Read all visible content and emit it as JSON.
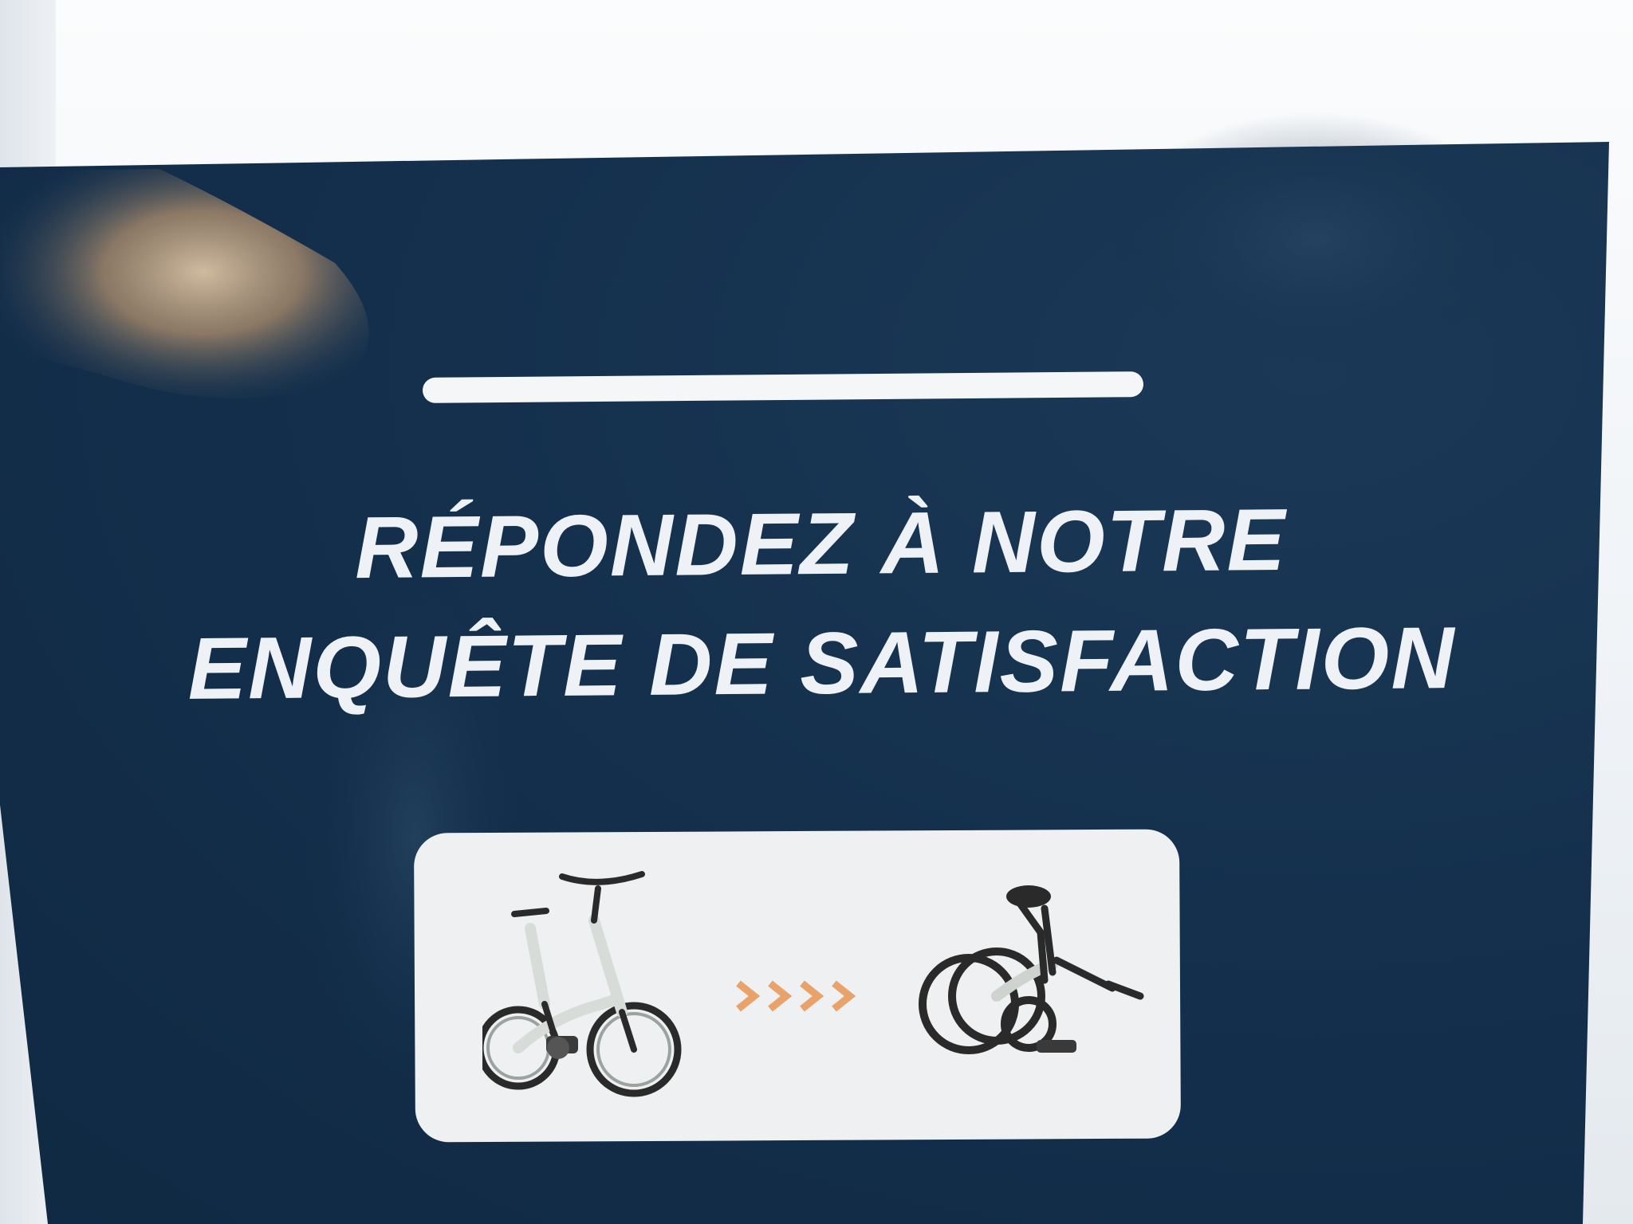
{
  "sign": {
    "headline_line1": "RÉPONDEZ À NOTRE",
    "headline_line2": "ENQUÊTE DE SATISFACTION"
  },
  "colors": {
    "panel": "#14304d",
    "text": "#eef1f5",
    "card": "#eef0f2",
    "arrow_accent": "#e8a26a"
  },
  "icons": {
    "unfolded": "unfolded-bike-icon",
    "folded": "folded-bike-icon",
    "arrows": "chevron-arrows-icon"
  }
}
